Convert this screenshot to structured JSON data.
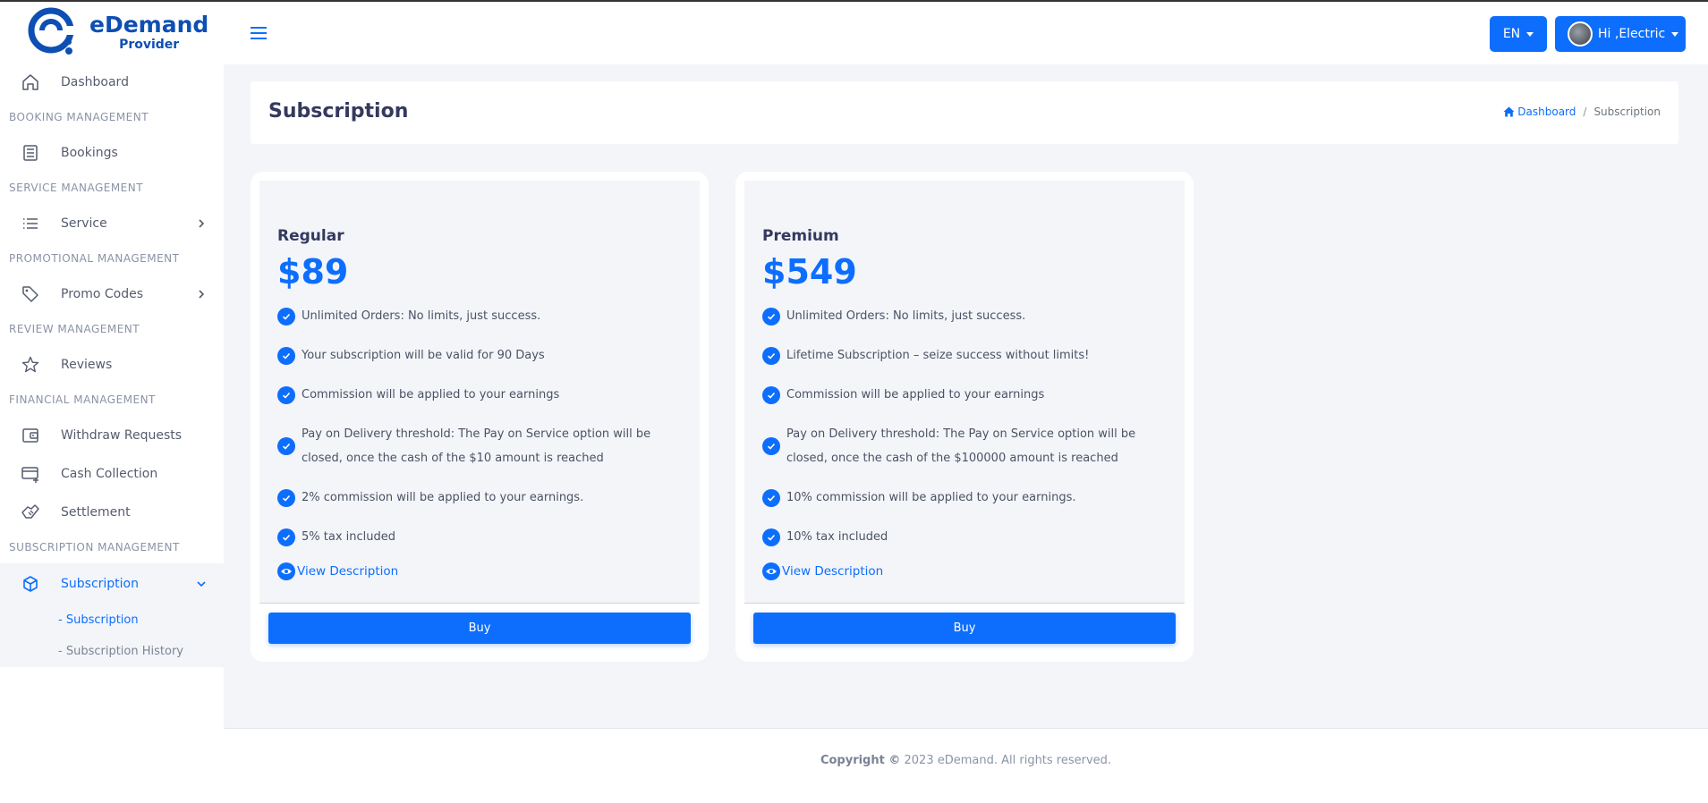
{
  "brand": {
    "name": "eDemand",
    "sub": "Provider",
    "color": "#0d4fb3"
  },
  "sidebar": {
    "items": [
      {
        "type": "item",
        "label": "Dashboard",
        "icon": "home-icon"
      },
      {
        "type": "head",
        "label": "BOOKING MANAGEMENT"
      },
      {
        "type": "item",
        "label": "Bookings",
        "icon": "list-box-icon"
      },
      {
        "type": "head",
        "label": "SERVICE MANAGEMENT"
      },
      {
        "type": "item",
        "label": "Service",
        "icon": "list-icon",
        "chevron": true
      },
      {
        "type": "head",
        "label": "PROMOTIONAL MANAGEMENT"
      },
      {
        "type": "item",
        "label": "Promo Codes",
        "icon": "tag-icon",
        "chevron": true
      },
      {
        "type": "head",
        "label": "REVIEW MANAGEMENT"
      },
      {
        "type": "item",
        "label": "Reviews",
        "icon": "star-icon"
      },
      {
        "type": "head",
        "label": "FINANCIAL MANAGEMENT"
      },
      {
        "type": "item",
        "label": "Withdraw Requests",
        "icon": "wallet-icon"
      },
      {
        "type": "item",
        "label": "Cash Collection",
        "icon": "card-plus-icon"
      },
      {
        "type": "item",
        "label": "Settlement",
        "icon": "handshake-icon"
      },
      {
        "type": "head",
        "label": "SUBSCRIPTION MANAGEMENT"
      }
    ],
    "active": {
      "label": "Subscription",
      "icon": "cube-icon"
    },
    "subitems": [
      {
        "label": "- Subscription",
        "active": true
      },
      {
        "label": "- Subscription History",
        "active": false
      }
    ]
  },
  "topbar": {
    "lang": "EN",
    "user": "Hi ,Electric"
  },
  "header": {
    "title": "Subscription",
    "breadcrumb": {
      "home": "Dashboard",
      "sep": "/",
      "current": "Subscription"
    }
  },
  "plans": [
    {
      "name": "Regular",
      "price": "$89",
      "features": [
        "Unlimited Orders: No limits, just success.",
        "Your subscription will be valid for 90 Days",
        "Commission will be applied to your earnings",
        "Pay on Delivery threshold: The Pay on Service option will be closed, once the cash of the $10 amount is reached",
        "2% commission will be applied to your earnings.",
        "5% tax included"
      ],
      "view": "View Description",
      "buy": "Buy"
    },
    {
      "name": "Premium",
      "price": "$549",
      "features": [
        "Unlimited Orders: No limits, just success.",
        "Lifetime Subscription – seize success without limits!",
        "Commission will be applied to your earnings",
        "Pay on Delivery threshold: The Pay on Service option will be closed, once the cash of the $100000 amount is reached",
        "10% commission will be applied to your earnings.",
        "10% tax included"
      ],
      "view": "View Description",
      "buy": "Buy"
    }
  ],
  "footer": {
    "bold": "Copyright ©",
    "rest": "2023 eDemand. All rights reserved."
  },
  "colors": {
    "accent": "#0d6efd",
    "background": "#f3f5f9"
  }
}
